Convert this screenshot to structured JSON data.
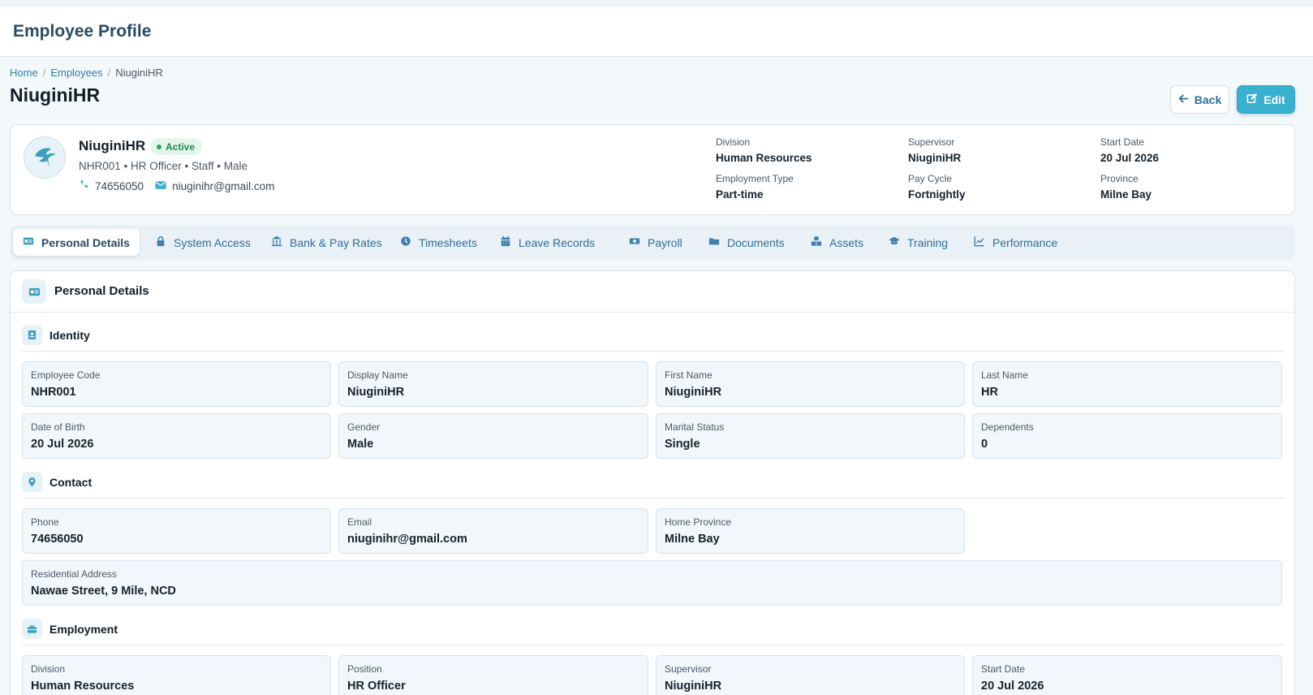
{
  "app": {
    "title": "Employee Profile"
  },
  "breadcrumb": {
    "items": [
      "Home",
      "Employees",
      "NiuginiHR"
    ],
    "separator": "/"
  },
  "page": {
    "title": "NiuginiHR"
  },
  "actions": {
    "back_label": "Back",
    "edit_label": "Edit"
  },
  "profile": {
    "name": "NiuginiHR",
    "status": "Active",
    "subtitle": "NHR001 • HR Officer • Staff • Male",
    "phone": "74656050",
    "email": "niuginihr@gmail.com",
    "avatar_icon": "bird-of-paradise-icon",
    "meta": [
      {
        "label": "Division",
        "value": "Human Resources"
      },
      {
        "label": "Supervisor",
        "value": "NiuginiHR"
      },
      {
        "label": "Start Date",
        "value": "20 Jul 2026"
      },
      {
        "label": "Employment Type",
        "value": "Part-time"
      },
      {
        "label": "Pay Cycle",
        "value": "Fortnightly"
      },
      {
        "label": "Province",
        "value": "Milne Bay"
      }
    ]
  },
  "tabs": [
    {
      "label": "Personal Details",
      "icon": "id-card-icon",
      "active": true
    },
    {
      "label": "System Access",
      "icon": "lock-icon"
    },
    {
      "label": "Bank & Pay Rates",
      "icon": "bank-icon"
    },
    {
      "label": "Timesheets",
      "icon": "clock-icon"
    },
    {
      "label": "Leave Records",
      "icon": "calendar-icon"
    },
    {
      "label": "Payroll",
      "icon": "money-icon"
    },
    {
      "label": "Documents",
      "icon": "folder-icon"
    },
    {
      "label": "Assets",
      "icon": "boxes-icon"
    },
    {
      "label": "Training",
      "icon": "graduation-cap-icon"
    },
    {
      "label": "Performance",
      "icon": "chart-line-icon"
    }
  ],
  "details": {
    "title": "Personal Details",
    "identity": {
      "title": "Identity",
      "fields": [
        {
          "label": "Employee Code",
          "value": "NHR001"
        },
        {
          "label": "Display Name",
          "value": "NiuginiHR"
        },
        {
          "label": "First Name",
          "value": "NiuginiHR"
        },
        {
          "label": "Last Name",
          "value": "HR"
        },
        {
          "label": "Date of Birth",
          "value": "20 Jul 2026"
        },
        {
          "label": "Gender",
          "value": "Male"
        },
        {
          "label": "Marital Status",
          "value": "Single"
        },
        {
          "label": "Dependents",
          "value": "0"
        }
      ]
    },
    "contact": {
      "title": "Contact",
      "fields": [
        {
          "label": "Phone",
          "value": "74656050"
        },
        {
          "label": "Email",
          "value": "niuginihr@gmail.com"
        },
        {
          "label": "Home Province",
          "value": "Milne Bay"
        },
        {
          "label": "Residential Address",
          "value": "Nawae Street, 9 Mile, NCD"
        }
      ]
    },
    "employment": {
      "title": "Employment",
      "fields": [
        {
          "label": "Division",
          "value": "Human Resources"
        },
        {
          "label": "Position",
          "value": "HR Officer"
        },
        {
          "label": "Supervisor",
          "value": "NiuginiHR"
        },
        {
          "label": "Start Date",
          "value": "20 Jul 2026"
        }
      ]
    }
  },
  "colors": {
    "accent": "#3ab0cf",
    "link": "#2f7fae",
    "status_active": "#1c8a4f"
  }
}
